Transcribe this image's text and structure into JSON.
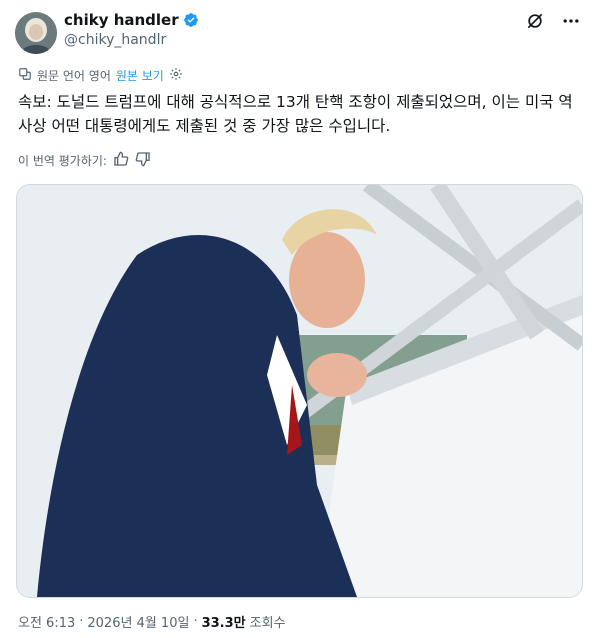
{
  "author": {
    "display_name": "chiky handler",
    "handle": "@chiky_handlr"
  },
  "translation_bar": {
    "source_language_label": "원문 언어 영어",
    "show_original_label": "원본 보기"
  },
  "tweet": {
    "text": "속보: 도널드 트럼프에 대해 공식적으로 13개 탄핵 조항이 제출되었으며, 이는 미국 역사상 어떤 대통령에게도 제출된 것 중 가장 많은 수입니다."
  },
  "rate_translation": {
    "label": "이 번역 평가하기:"
  },
  "meta": {
    "time": "오전 6:13",
    "separator": "·",
    "date": "2026년 4월 10일",
    "views_count": "33.3만",
    "views_label": "조회수"
  },
  "colors": {
    "link": "#1d9bf0",
    "secondary_text": "#536471",
    "verified": "#1d9bf0"
  },
  "icons": {
    "verified": "verified-badge-icon",
    "grok": "grok-icon",
    "more": "more-icon",
    "translate": "translate-icon",
    "settings": "gear-icon",
    "thumbs_up": "thumbs-up-icon",
    "thumbs_down": "thumbs-down-icon"
  }
}
